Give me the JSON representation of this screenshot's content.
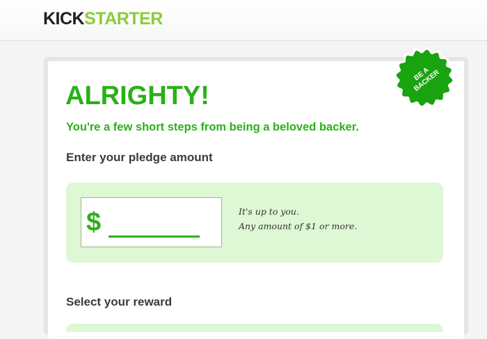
{
  "brand": {
    "name_part1": "KICK",
    "name_part2": "STARTER"
  },
  "badge": {
    "line1": "BE A",
    "line2": "BACKER",
    "color": "#19a30f"
  },
  "page": {
    "headline": "ALRIGHTY!",
    "subheadline": "You're a few short steps from being a beloved backer."
  },
  "pledge": {
    "label": "Enter your pledge amount",
    "currency_symbol": "$",
    "amount_value": "",
    "hint_line1": "It's up to you.",
    "hint_line2": "Any amount of $1 or more."
  },
  "reward": {
    "label": "Select your reward"
  },
  "colors": {
    "accent_green": "#2bb019",
    "logo_green": "#8acc3a",
    "panel_green": "#def7d4",
    "label_text": "#3a3a3a"
  }
}
